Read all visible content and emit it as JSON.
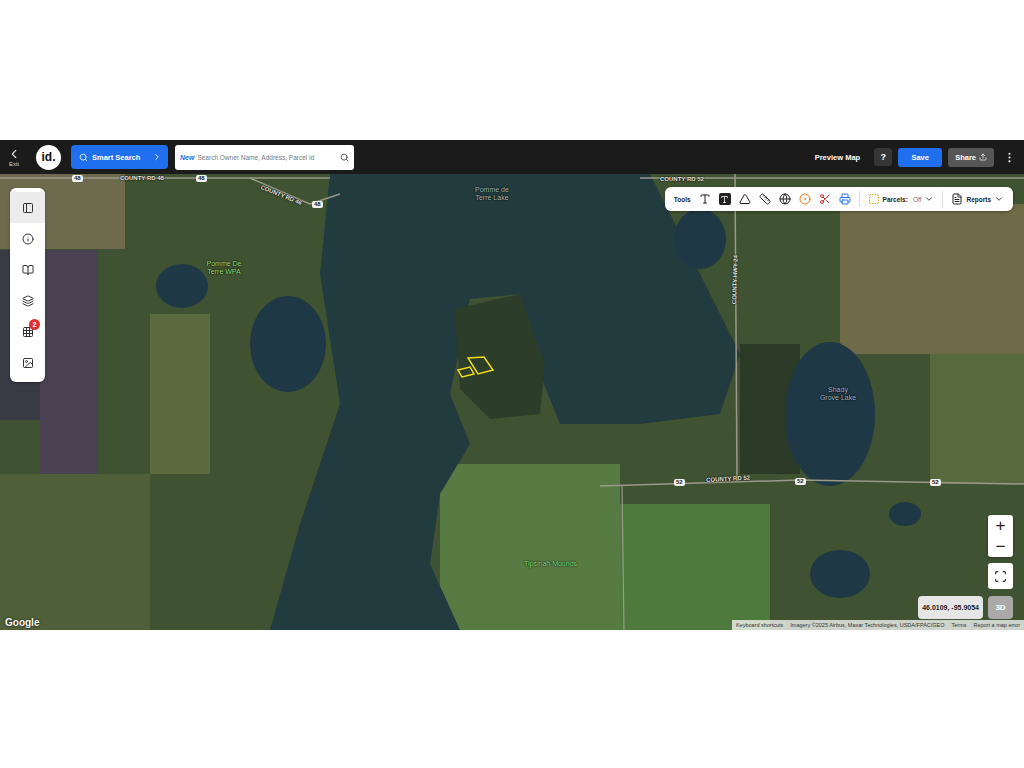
{
  "header": {
    "exit": "Exit",
    "logo": "id.",
    "smart_search": "Smart Search",
    "search": {
      "badge": "New",
      "placeholder": "Search Owner Name, Address, Parcel Id"
    },
    "preview": "Preview Map",
    "help": "?",
    "save": "Save",
    "share": "Share"
  },
  "sidebar": {
    "items": [
      {
        "badge": null
      },
      {
        "badge": null
      },
      {
        "badge": null
      },
      {
        "badge": null
      },
      {
        "badge": "2"
      },
      {
        "badge": null
      }
    ]
  },
  "toolbar": {
    "label": "Tools",
    "parcels": {
      "label": "Parcels:",
      "value": "Off"
    },
    "reports": "Reports"
  },
  "map": {
    "labels": [
      {
        "text": "48",
        "kind": "shield"
      },
      {
        "text": "COUNTY RD 48",
        "kind": "road"
      },
      {
        "text": "48",
        "kind": "shield"
      },
      {
        "text": "COUNTY RD 46",
        "kind": "road"
      },
      {
        "text": "48",
        "kind": "shield"
      },
      {
        "text": "Pomme de Terre Lake",
        "kind": "water"
      },
      {
        "text": "Pomme De Terre WPA",
        "kind": "place"
      },
      {
        "text": "COUNTY RD 52",
        "kind": "road"
      },
      {
        "text": "Shady Grove Lake",
        "kind": "water"
      },
      {
        "text": "COUNTY RD 52",
        "kind": "road"
      },
      {
        "text": "52",
        "kind": "shield"
      },
      {
        "text": "52",
        "kind": "shield"
      },
      {
        "text": "52",
        "kind": "shield"
      },
      {
        "text": "COUNTY HWY 24",
        "kind": "road"
      },
      {
        "text": "Tipsinah Mounds",
        "kind": "place"
      }
    ]
  },
  "zoom": {
    "in": "+",
    "out": "−"
  },
  "coordinates": "46.0109, -95.9054",
  "view_3d": "3D",
  "attribution": {
    "logo": "Google",
    "links": [
      "Keyboard shortcuts",
      "Imagery ©2025 Airbus, Maxar Technologies, USDA/FPAC/GEO",
      "Terms",
      "Report a map error"
    ]
  }
}
